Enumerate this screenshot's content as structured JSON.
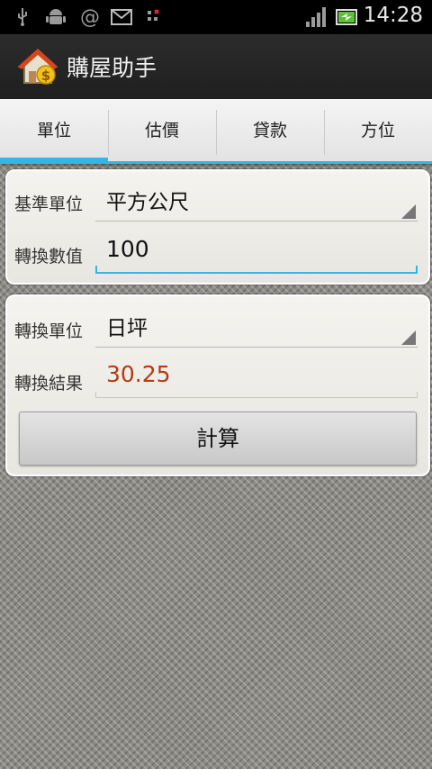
{
  "status_bar": {
    "time": "14:28",
    "icons": [
      "usb-icon",
      "android-debug-icon",
      "at-sign-icon",
      "gmail-icon",
      "data-sync-icon",
      "signal-icon",
      "battery-charging-icon"
    ]
  },
  "action_bar": {
    "title": "購屋助手",
    "icon": "house-dollar-icon"
  },
  "tabs": [
    {
      "label": "單位",
      "active": true
    },
    {
      "label": "估價"
    },
    {
      "label": "貸款"
    },
    {
      "label": "方位"
    }
  ],
  "card1": {
    "base_unit_label": "基準單位",
    "base_unit_value": "平方公尺",
    "convert_value_label": "轉換數值",
    "convert_value": "100"
  },
  "card2": {
    "target_unit_label": "轉換單位",
    "target_unit_value": "日坪",
    "result_label": "轉換結果",
    "result_value": "30.25",
    "calc_button": "計算"
  },
  "colors": {
    "accent": "#33b5e5",
    "result_text": "#b53a10"
  }
}
